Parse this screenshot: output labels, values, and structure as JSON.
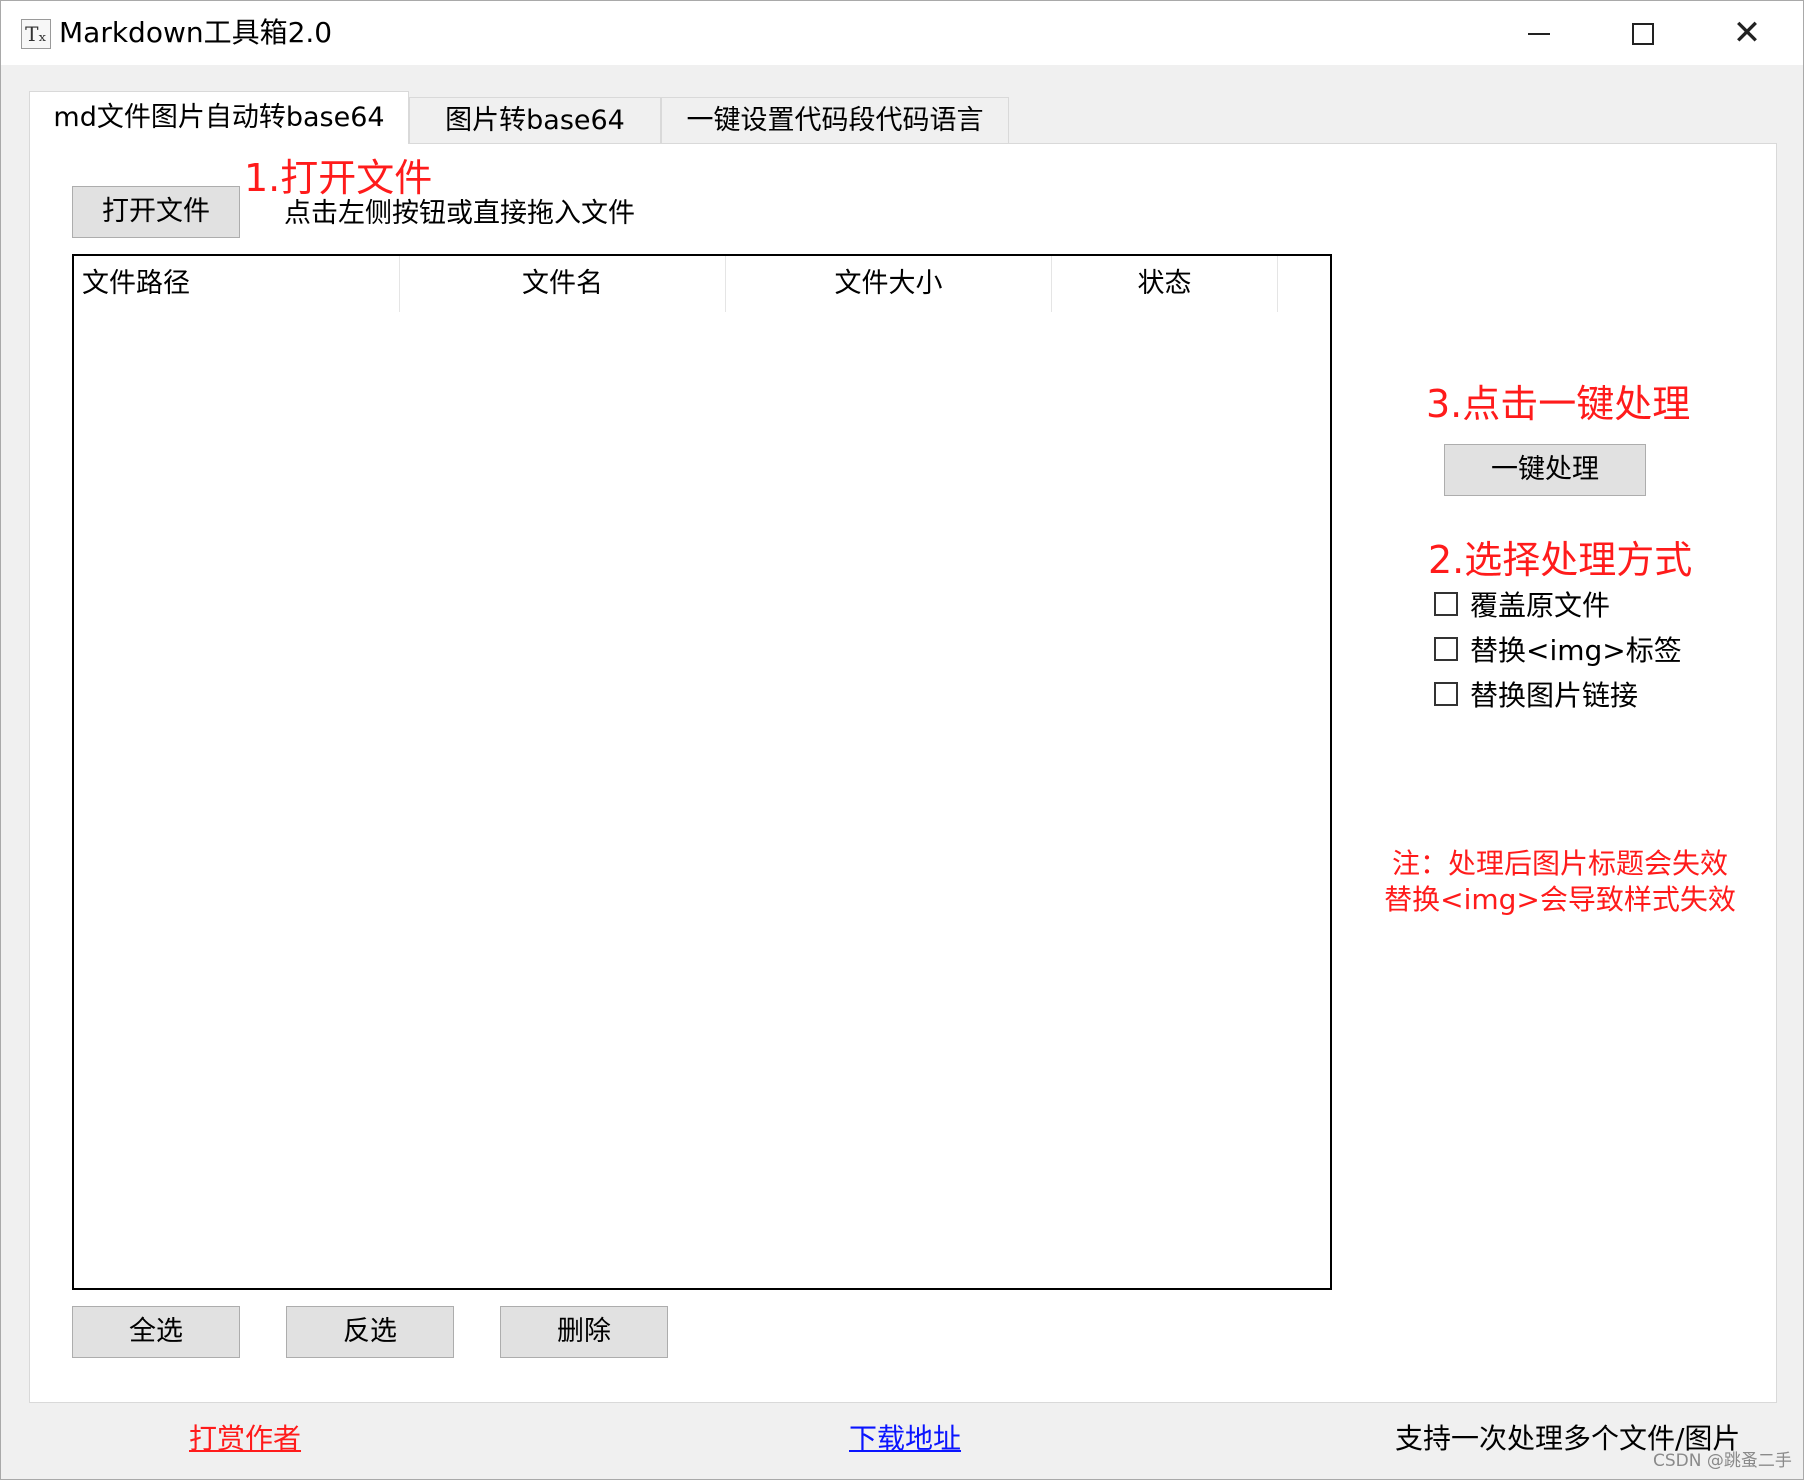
{
  "window": {
    "icon_glyph": "Tₓ",
    "title": "Markdown工具箱2.0"
  },
  "tabs": [
    {
      "label": "md文件图片自动转base64"
    },
    {
      "label": "图片转base64"
    },
    {
      "label": "一键设置代码段代码语言"
    }
  ],
  "main": {
    "step1": "1.打开文件",
    "open_button": "打开文件",
    "hint": "点击左侧按钮或直接拖入文件",
    "table_headers": [
      "文件路径",
      "文件名",
      "文件大小",
      "状态"
    ],
    "step3": "3.点击一键处理",
    "process_button": "一键处理",
    "step2": "2.选择处理方式",
    "options": [
      "覆盖原文件",
      "替换<img>标签",
      "替换图片链接"
    ],
    "note_line1": "注：处理后图片标题会失效",
    "note_line2": "替换<img>会导致样式失效",
    "select_all": "全选",
    "invert": "反选",
    "delete": "删除"
  },
  "footer": {
    "reward": "打赏作者",
    "download": "下载地址",
    "support": "支持一次处理多个文件/图片"
  },
  "watermark": "CSDN @跳蚤二手",
  "colors": {
    "annotation": "#ff1b1b",
    "link": "#0a14ff"
  }
}
